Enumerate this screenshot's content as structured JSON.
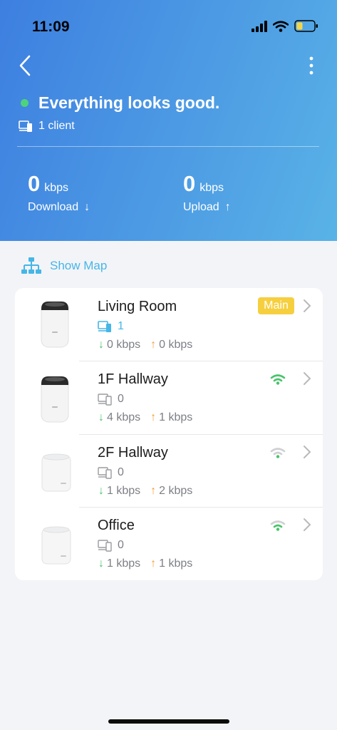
{
  "status_bar": {
    "time": "11:09",
    "icons": [
      "signal-icon",
      "wifi-icon",
      "battery-icon"
    ]
  },
  "header": {
    "status_text": "Everything looks good.",
    "status_color": "#4fd37a",
    "clients_text": "1 client",
    "download": {
      "value": "0",
      "unit": "kbps",
      "label": "Download",
      "arrow": "↓"
    },
    "upload": {
      "value": "0",
      "unit": "kbps",
      "label": "Upload",
      "arrow": "↑"
    }
  },
  "show_map_label": "Show Map",
  "nodes": [
    {
      "name": "Living Room",
      "clients": "1",
      "down": "0 kbps",
      "up": "0 kbps",
      "badge": "Main",
      "model": "tower"
    },
    {
      "name": "1F Hallway",
      "clients": "0",
      "down": "4 kbps",
      "up": "1 kbps",
      "signal": "strong",
      "model": "tower"
    },
    {
      "name": "2F Hallway",
      "clients": "0",
      "down": "1 kbps",
      "up": "2 kbps",
      "signal": "weak",
      "model": "cube"
    },
    {
      "name": "Office",
      "clients": "0",
      "down": "1 kbps",
      "up": "1 kbps",
      "signal": "medium",
      "model": "cube"
    }
  ],
  "colors": {
    "accent": "#46b6e6",
    "header_start": "#3d7fe0",
    "header_end": "#59b3e6",
    "down_arrow": "#4cc36b",
    "up_arrow": "#f0a23a",
    "main_badge": "#f6cf3f"
  }
}
